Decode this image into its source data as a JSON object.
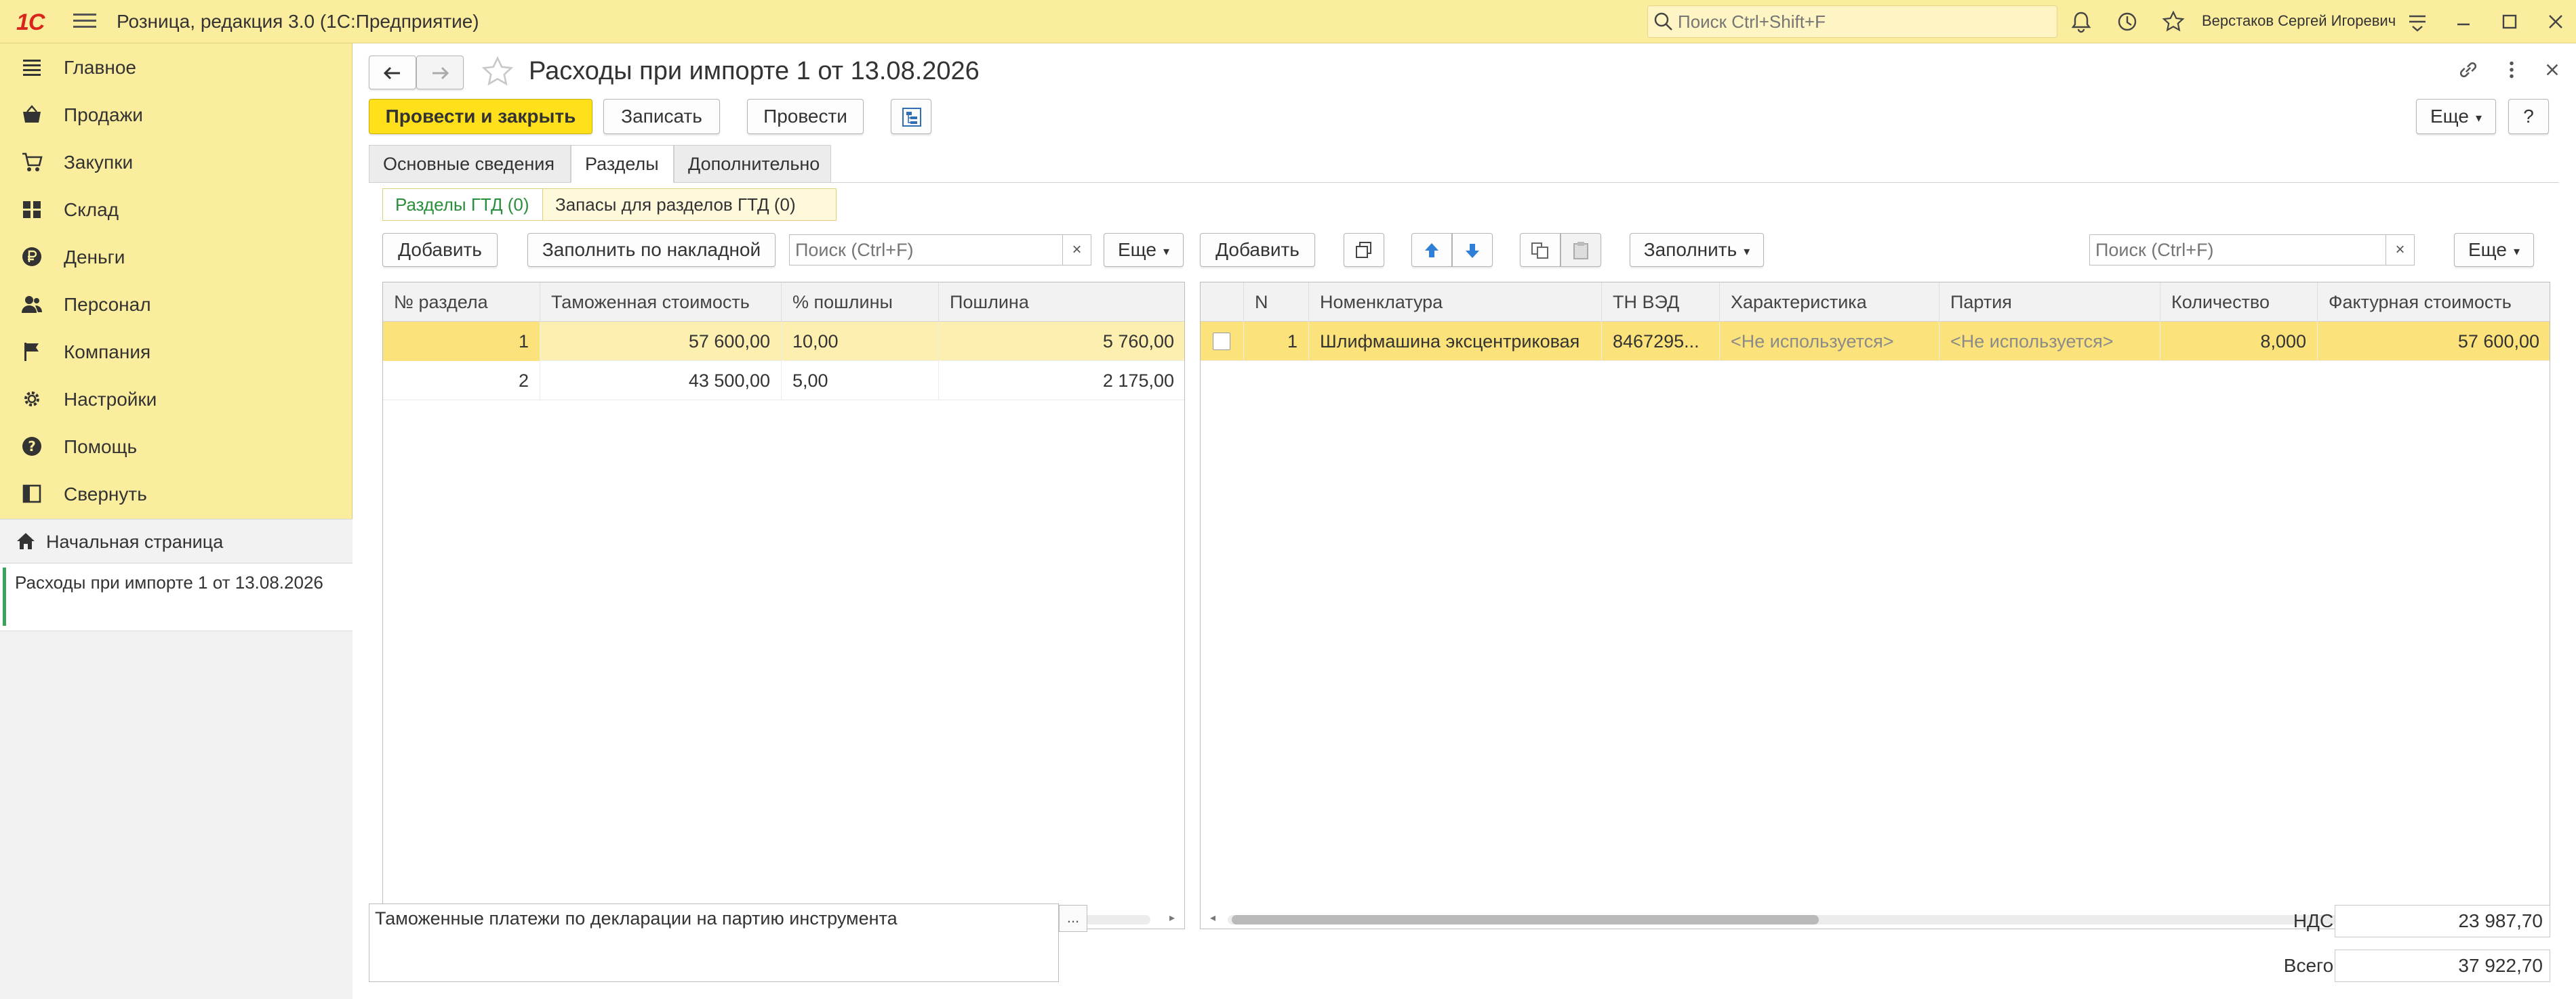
{
  "app": {
    "logo": "1С",
    "title": "Розница, редакция 3.0  (1С:Предприятие)",
    "search_placeholder": "Поиск Ctrl+Shift+F",
    "user": "Верстаков Сергей Игоревич"
  },
  "sidebar": {
    "items": [
      {
        "label": "Главное",
        "icon": "menu-lines-icon"
      },
      {
        "label": "Продажи",
        "icon": "basket-icon"
      },
      {
        "label": "Закупки",
        "icon": "cart-icon"
      },
      {
        "label": "Склад",
        "icon": "warehouse-icon"
      },
      {
        "label": "Деньги",
        "icon": "ruble-icon"
      },
      {
        "label": "Персонал",
        "icon": "people-icon"
      },
      {
        "label": "Компания",
        "icon": "flag-icon"
      },
      {
        "label": "Настройки",
        "icon": "gear-icon"
      },
      {
        "label": "Помощь",
        "icon": "help-icon"
      },
      {
        "label": "Свернуть",
        "icon": "collapse-icon"
      }
    ],
    "home": "Начальная страница",
    "open_doc": "Расходы при импорте 1 от 13.08.2026"
  },
  "document": {
    "title": "Расходы при импорте 1 от 13.08.2026",
    "buttons": {
      "post_close": "Провести и закрыть",
      "save": "Записать",
      "post": "Провести",
      "more": "Еще",
      "help": "?"
    },
    "tabs": [
      "Основные сведения",
      "Разделы",
      "Дополнительно"
    ],
    "active_tab": "Разделы",
    "subtabs": [
      "Разделы ГТД (0)",
      "Запасы для разделов ГТД (0)"
    ],
    "active_subtab": "Разделы ГТД (0)"
  },
  "left_table": {
    "toolbar": {
      "add": "Добавить",
      "fill_by_invoice": "Заполнить по накладной",
      "search_placeholder": "Поиск (Ctrl+F)",
      "clear": "×",
      "more": "Еще"
    },
    "columns": [
      "№ раздела",
      "Таможенная стоимость",
      "% пошлины",
      "Пошлина"
    ],
    "rows": [
      [
        "1",
        "57 600,00",
        "10,00",
        "5 760,00"
      ],
      [
        "2",
        "43 500,00",
        "5,00",
        "2 175,00"
      ]
    ],
    "selected_row": 1
  },
  "right_table": {
    "toolbar": {
      "add": "Добавить",
      "fill": "Заполнить",
      "search_placeholder": "Поиск (Ctrl+F)",
      "clear": "×",
      "more": "Еще"
    },
    "columns": [
      "N",
      "Номенклатура",
      "ТН ВЭД",
      "Характеристика",
      "Партия",
      "Количество",
      "Фактурная стоимость"
    ],
    "rows": [
      [
        "1",
        "Шлифмашина эксцентриковая",
        "8467295...",
        "<Не используется>",
        "<Не используется>",
        "8,000",
        "57 600,00"
      ]
    ],
    "selected_row": 1
  },
  "footer": {
    "comment": "Таможенные платежи по декларации на партию инструмента",
    "comment_btn": "...",
    "vat_label": "НДС:",
    "vat_value": "23 987,70",
    "total_label": "Всего:",
    "total_value": "37 922,70"
  },
  "colors": {
    "accent_yellow": "#ffe01b",
    "sidebar_bg": "#fbed9e",
    "selected_row": "#fcefb0",
    "active_subtab": "#2a8f3a"
  }
}
